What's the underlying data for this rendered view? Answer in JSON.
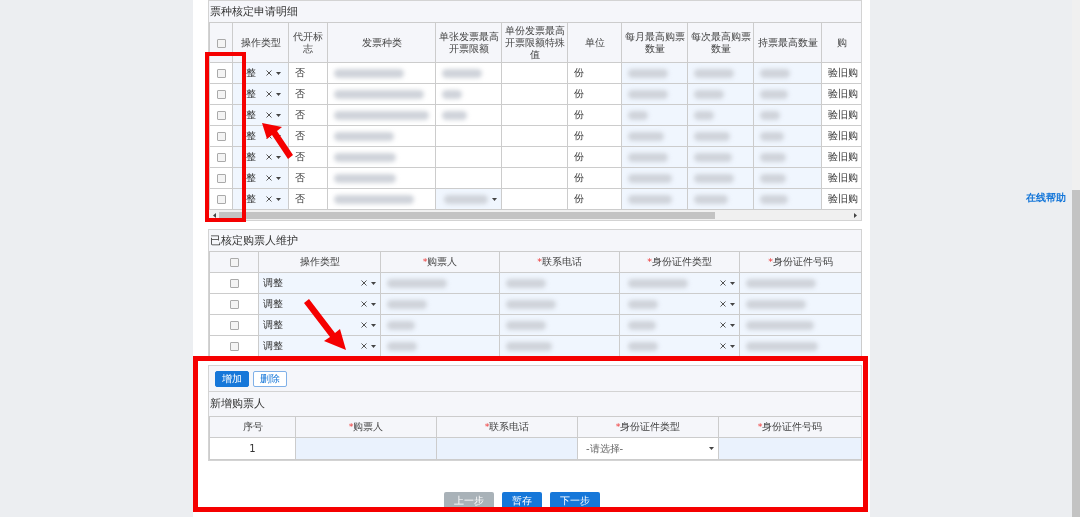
{
  "invoice_detail": {
    "title": "票种核定申请明细",
    "all_selected": false,
    "columns": [
      "操作类型",
      "代开标志",
      "发票种类",
      "单张发票最高开票限额",
      "单份发票最高开票限额特殊值",
      "单位",
      "每月最高购票数量",
      "每次最高购票数量",
      "持票最高数量",
      "购"
    ],
    "rows": [
      {
        "selected": false,
        "operation": "整",
        "proxy_flag": "否",
        "single_limit": {
          "kind": "redacted"
        },
        "unit": "份",
        "column_11": "验旧购"
      },
      {
        "selected": false,
        "operation": "整",
        "proxy_flag": "否",
        "single_limit": {
          "kind": "redacted"
        },
        "unit": "份",
        "column_11": "验旧购"
      },
      {
        "selected": false,
        "operation": "整",
        "proxy_flag": "否",
        "single_limit": {
          "kind": "redacted"
        },
        "unit": "份",
        "column_11": "验旧购"
      },
      {
        "selected": false,
        "operation": "整",
        "proxy_flag": "否",
        "single_limit": {
          "kind": "empty"
        },
        "unit": "份",
        "column_11": "验旧购"
      },
      {
        "selected": false,
        "operation": "整",
        "proxy_flag": "否",
        "single_limit": {
          "kind": "empty"
        },
        "unit": "份",
        "column_11": "验旧购"
      },
      {
        "selected": false,
        "operation": "整",
        "proxy_flag": "否",
        "single_limit": {
          "kind": "empty"
        },
        "unit": "份",
        "column_11": "验旧购"
      },
      {
        "selected": false,
        "operation": "整",
        "proxy_flag": "否",
        "single_limit": {
          "kind": "select"
        },
        "unit": "份",
        "column_11": "验旧购"
      }
    ]
  },
  "buyers": {
    "title": "已核定购票人维护",
    "all_selected": false,
    "columns": [
      {
        "label": "操作类型"
      },
      {
        "mark": "*",
        "label": "购票人"
      },
      {
        "mark": "*",
        "label": "联系电话"
      },
      {
        "mark": "*",
        "label": "身份证件类型"
      },
      {
        "mark": "*",
        "label": "身份证件号码"
      }
    ],
    "rows": [
      {
        "selected": false,
        "operation": "调整"
      },
      {
        "selected": false,
        "operation": "调整"
      },
      {
        "selected": false,
        "operation": "调整"
      },
      {
        "selected": false,
        "operation": "调整"
      }
    ]
  },
  "new_buyers": {
    "toolbar": [
      {
        "label": "增加",
        "kind": "primary"
      },
      {
        "label": "删除",
        "kind": "outline"
      }
    ],
    "title": "新增购票人",
    "columns": [
      {
        "label": "序号"
      },
      {
        "mark": "*",
        "label": "购票人"
      },
      {
        "mark": "*",
        "label": "联系电话"
      },
      {
        "mark": "*",
        "label": "身份证件类型"
      },
      {
        "mark": "*",
        "label": "身份证件号码"
      }
    ],
    "rows": [
      {
        "index": "1",
        "id_type_placeholder": "-请选择-"
      }
    ]
  },
  "buttons": [
    {
      "label": "上一步",
      "disabled": true
    },
    {
      "label": "暂存",
      "disabled": false
    },
    {
      "label": "下一步",
      "disabled": false
    }
  ],
  "help_link": "在线帮助"
}
